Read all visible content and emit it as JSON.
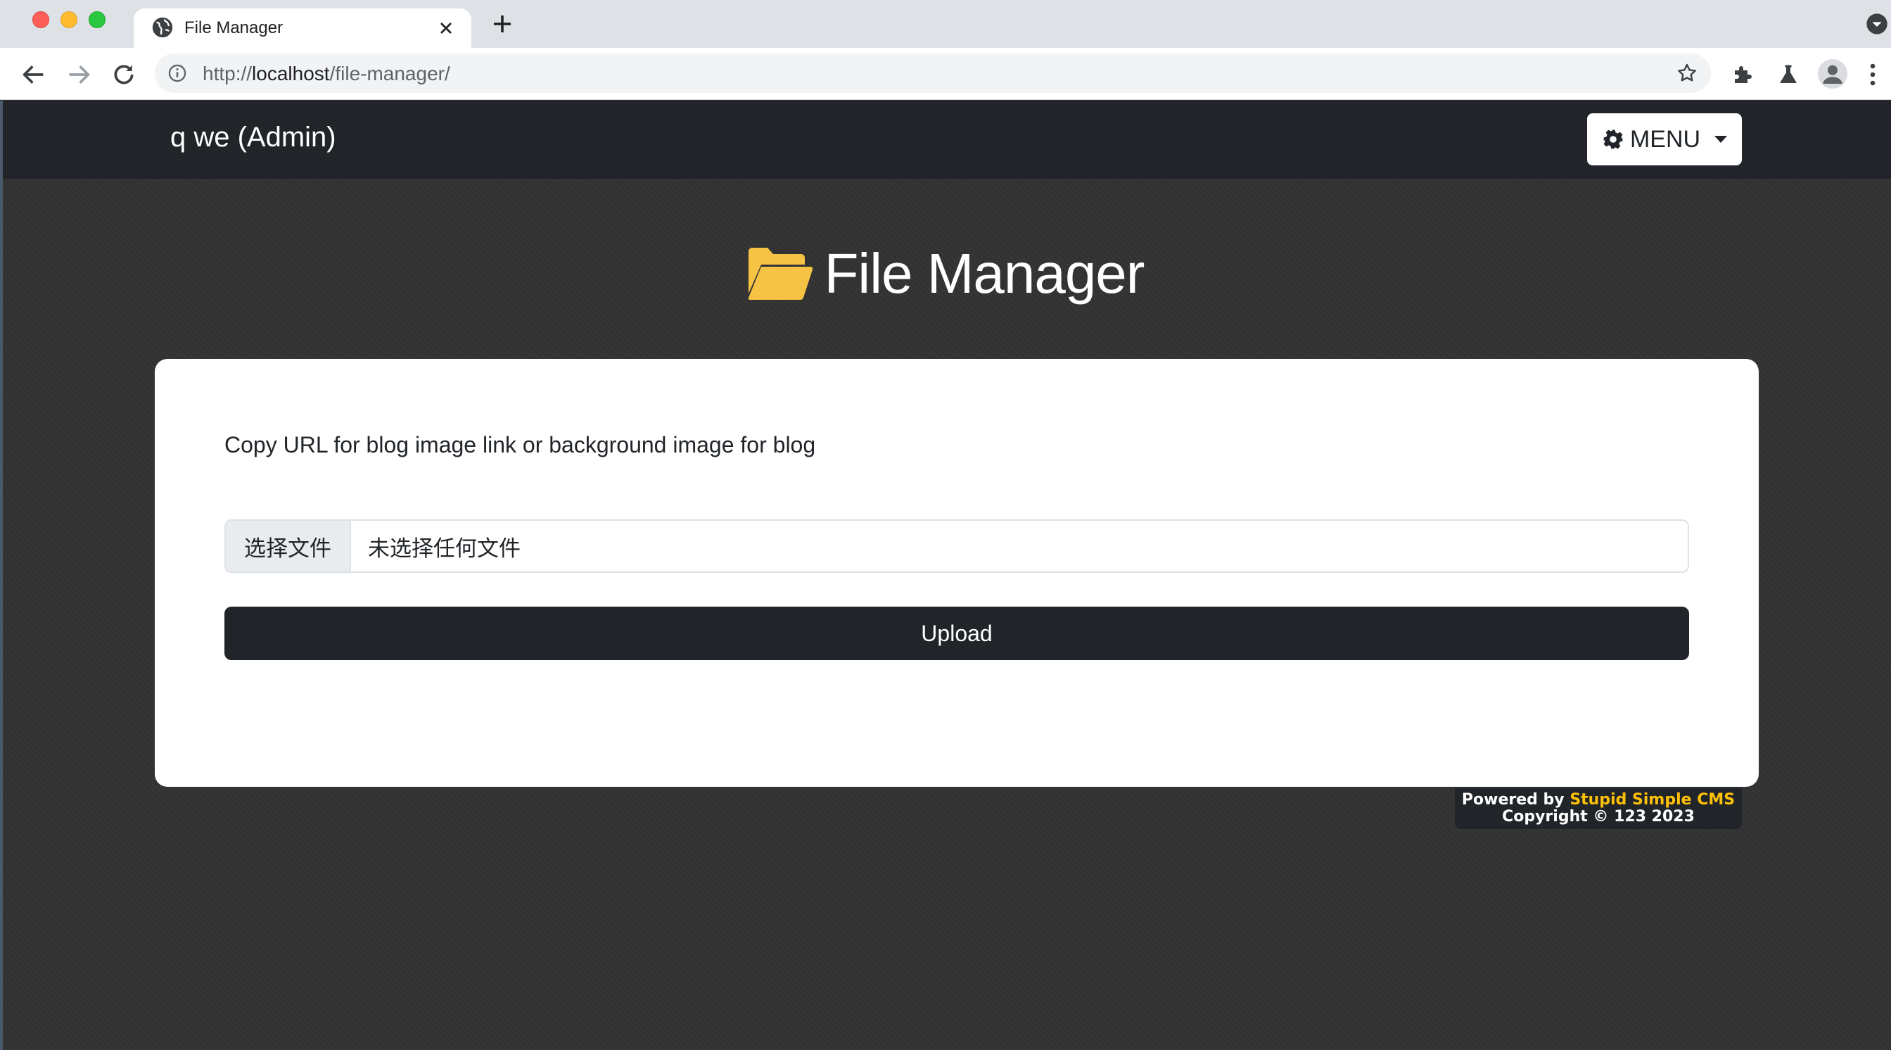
{
  "browser": {
    "tab_title": "File Manager",
    "url_scheme": "http://",
    "url_host": "localhost",
    "url_path": "/file-manager/"
  },
  "navbar": {
    "brand": "q we (Admin)",
    "menu_label": "MENU"
  },
  "page": {
    "title": "File Manager",
    "description": "Copy URL for blog image link or background image for blog",
    "file_button_label": "选择文件",
    "file_status": "未选择任何文件",
    "upload_label": "Upload"
  },
  "footer": {
    "powered_prefix": "Powered by ",
    "cms_name": "Stupid Simple CMS",
    "copyright": "Copyright © 123 2023"
  },
  "colors": {
    "navbar_bg": "#212529",
    "page_bg": "#323232",
    "folder_icon": "#f6c344",
    "cms_accent": "#ffc107"
  },
  "icons": [
    "globe-icon",
    "close-icon",
    "plus-icon",
    "back-arrow-icon",
    "forward-arrow-icon",
    "reload-icon",
    "info-icon",
    "star-icon",
    "puzzle-icon",
    "labs-flask-icon",
    "profile-icon",
    "more-vert-icon",
    "gear-icon",
    "caret-down-icon",
    "open-folder-icon"
  ]
}
